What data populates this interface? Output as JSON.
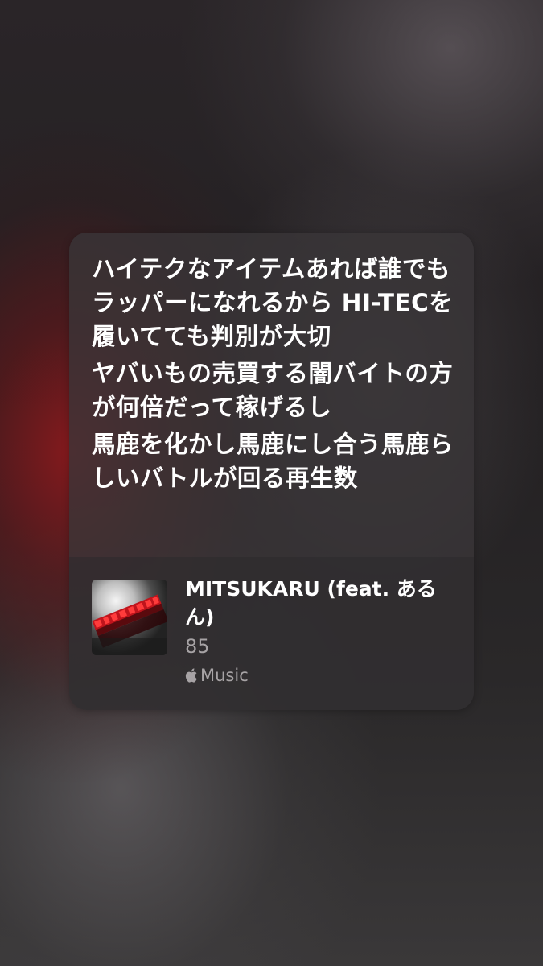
{
  "lyrics": {
    "lines": [
      "ハイテクなアイテムあれば誰でもラッパーになれるから HI-TECを履いてても判別が大切",
      "ヤバいもの売買する闇バイトの方が何倍だって稼げるし",
      "馬鹿を化かし馬鹿にし合う馬鹿らしいバトルが回る再生数"
    ]
  },
  "song": {
    "title": "MITSUKARU (feat. あるん)",
    "track_number": "85",
    "service_label": "Music",
    "service_icon": "apple-logo-icon"
  },
  "cover_art": {
    "icon": "album-cover-image",
    "accent_color": "#c0141c"
  }
}
